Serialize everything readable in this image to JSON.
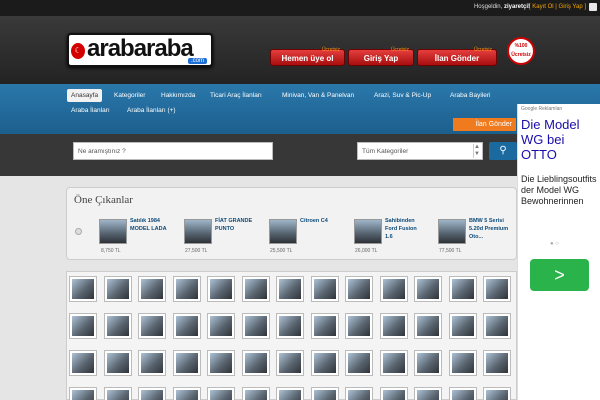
{
  "topbar": {
    "greeting": "Hoşgeldin,",
    "user": "ziyaretçi!",
    "links": "[ Kayıt Ol | Giriş Yap ]"
  },
  "logo": {
    "text": "arabaraba",
    "com": ".com"
  },
  "header_buttons": [
    {
      "label": "Hemen üye ol",
      "tag": "Ücretsiz"
    },
    {
      "label": "Giriş Yap",
      "tag": "Ücretsiz"
    },
    {
      "label": "İlan Gönder",
      "tag": "Ücretsiz"
    }
  ],
  "badge": {
    "text": "%100 Ücretsiz"
  },
  "nav": {
    "items": [
      "Anasayfa",
      "Kategoriler",
      "Hakkımızda",
      "Ticari Araç İlanları",
      "Minivan, Van & Panelvan",
      "Arazi, Suv & Pic-Up",
      "Araba Bayileri",
      "Araba İlanları",
      "Araba İlanları (+)"
    ],
    "post_button": "İlan Gönder"
  },
  "search": {
    "placeholder": "Ne aramıştınız ?",
    "category": "Tüm Kategoriler"
  },
  "featured": {
    "title": "Öne Çıkanlar",
    "items": [
      {
        "name": "Satılık 1984 MODEL LADA",
        "price": "8,750 TL"
      },
      {
        "name": "FİAT GRANDE PUNTO",
        "price": "27,500 TL"
      },
      {
        "name": "Citroen C4",
        "price": "25,500 TL"
      },
      {
        "name": "Sahibinden Ford Fusion 1.6",
        "price": "26,000 TL"
      },
      {
        "name": "BMW 5 Serisi 5.20d Premium Oto...",
        "price": "77,500 TL"
      }
    ]
  },
  "ad": {
    "network": "Google Reklamları",
    "headline": "Die Model WG bei OTTO",
    "body": "Die Lieblingsoutfits der Model WG Bewohnerinnen",
    "dots": "● ○"
  }
}
